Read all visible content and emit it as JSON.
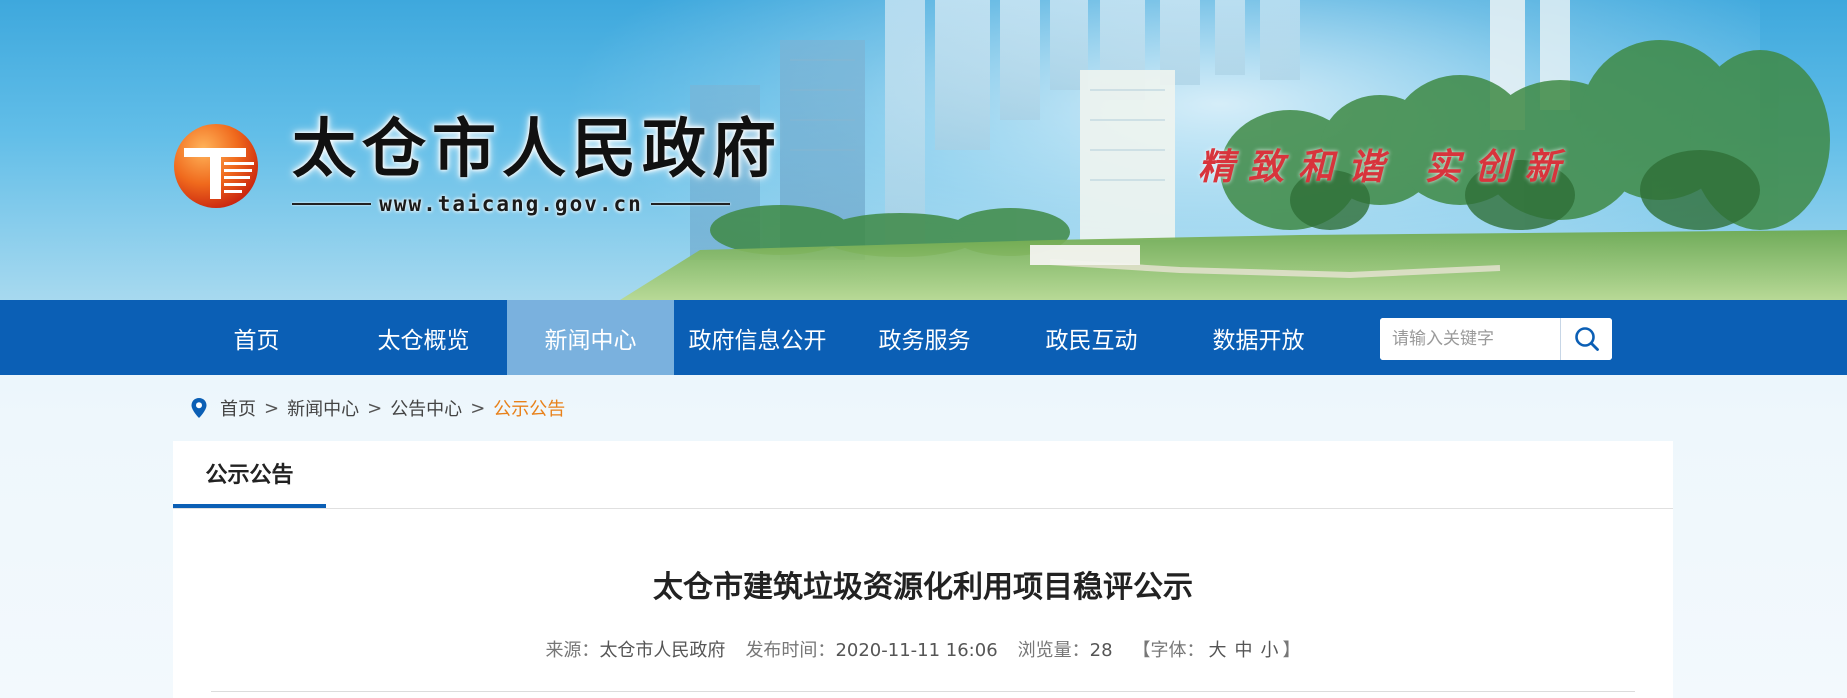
{
  "header": {
    "site_title": "太仓市人民政府",
    "site_url": "www.taicang.gov.cn",
    "slogan": "精致和谐 实创新"
  },
  "nav": {
    "items": [
      {
        "label": "首页",
        "active": false
      },
      {
        "label": "太仓概览",
        "active": false
      },
      {
        "label": "新闻中心",
        "active": true
      },
      {
        "label": "政府信息公开",
        "active": false
      },
      {
        "label": "政务服务",
        "active": false
      },
      {
        "label": "政民互动",
        "active": false
      },
      {
        "label": "数据开放",
        "active": false
      }
    ],
    "search_placeholder": "请输入关键字"
  },
  "breadcrumb": {
    "items": [
      "首页",
      "新闻中心",
      "公告中心",
      "公示公告"
    ],
    "separator": ">"
  },
  "section": {
    "tab_label": "公示公告"
  },
  "article": {
    "title": "太仓市建筑垃圾资源化利用项目稳评公示",
    "source_label": "来源：",
    "source": "太仓市人民政府",
    "publish_label": "发布时间：",
    "publish_time": "2020-11-11 16:06",
    "views_label": "浏览量：",
    "views": "28",
    "font_label_open": "【字体：",
    "font_sizes": [
      "大",
      "中",
      "小"
    ],
    "font_label_close": "】"
  },
  "colors": {
    "nav_bg": "#0b5fb5",
    "nav_active": "#7ab1de",
    "breadcrumb_current": "#e8811a",
    "slogan": "#d8343c"
  }
}
